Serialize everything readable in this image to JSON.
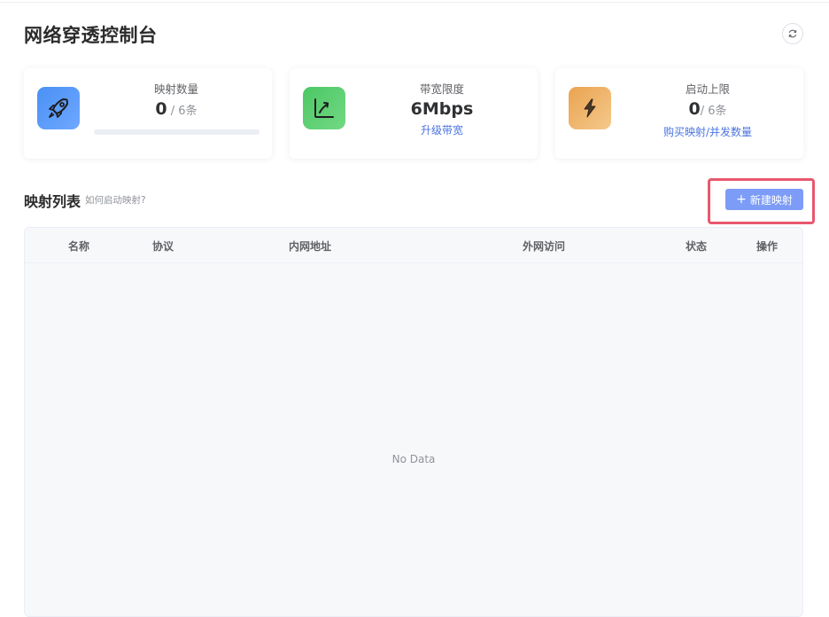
{
  "header": {
    "title": "网络穿透控制台"
  },
  "stats": {
    "mappings": {
      "label": "映射数量",
      "value": "0",
      "total": " / 6条",
      "progress_percent": 0
    },
    "bandwidth": {
      "label": "带宽限度",
      "value": "6Mbps",
      "link": "升级带宽"
    },
    "launch": {
      "label": "启动上限",
      "value": "0",
      "total": "/ 6条",
      "link": "购买映射/并发数量"
    }
  },
  "list": {
    "title": "映射列表",
    "help": "如何启动映射?",
    "new_button": "新建映射",
    "columns": [
      "名称",
      "协议",
      "内网地址",
      "外网访问",
      "状态",
      "操作"
    ],
    "empty_text": "No Data"
  },
  "colors": {
    "accent": "#7c9cf7",
    "highlight": "#e8586e",
    "link": "#4b74e0"
  },
  "icons": {
    "refresh": "refresh-icon",
    "mappings": "rocket-icon",
    "bandwidth": "chart-trend-icon",
    "launch": "lightning-icon",
    "new": "plus-icon"
  }
}
